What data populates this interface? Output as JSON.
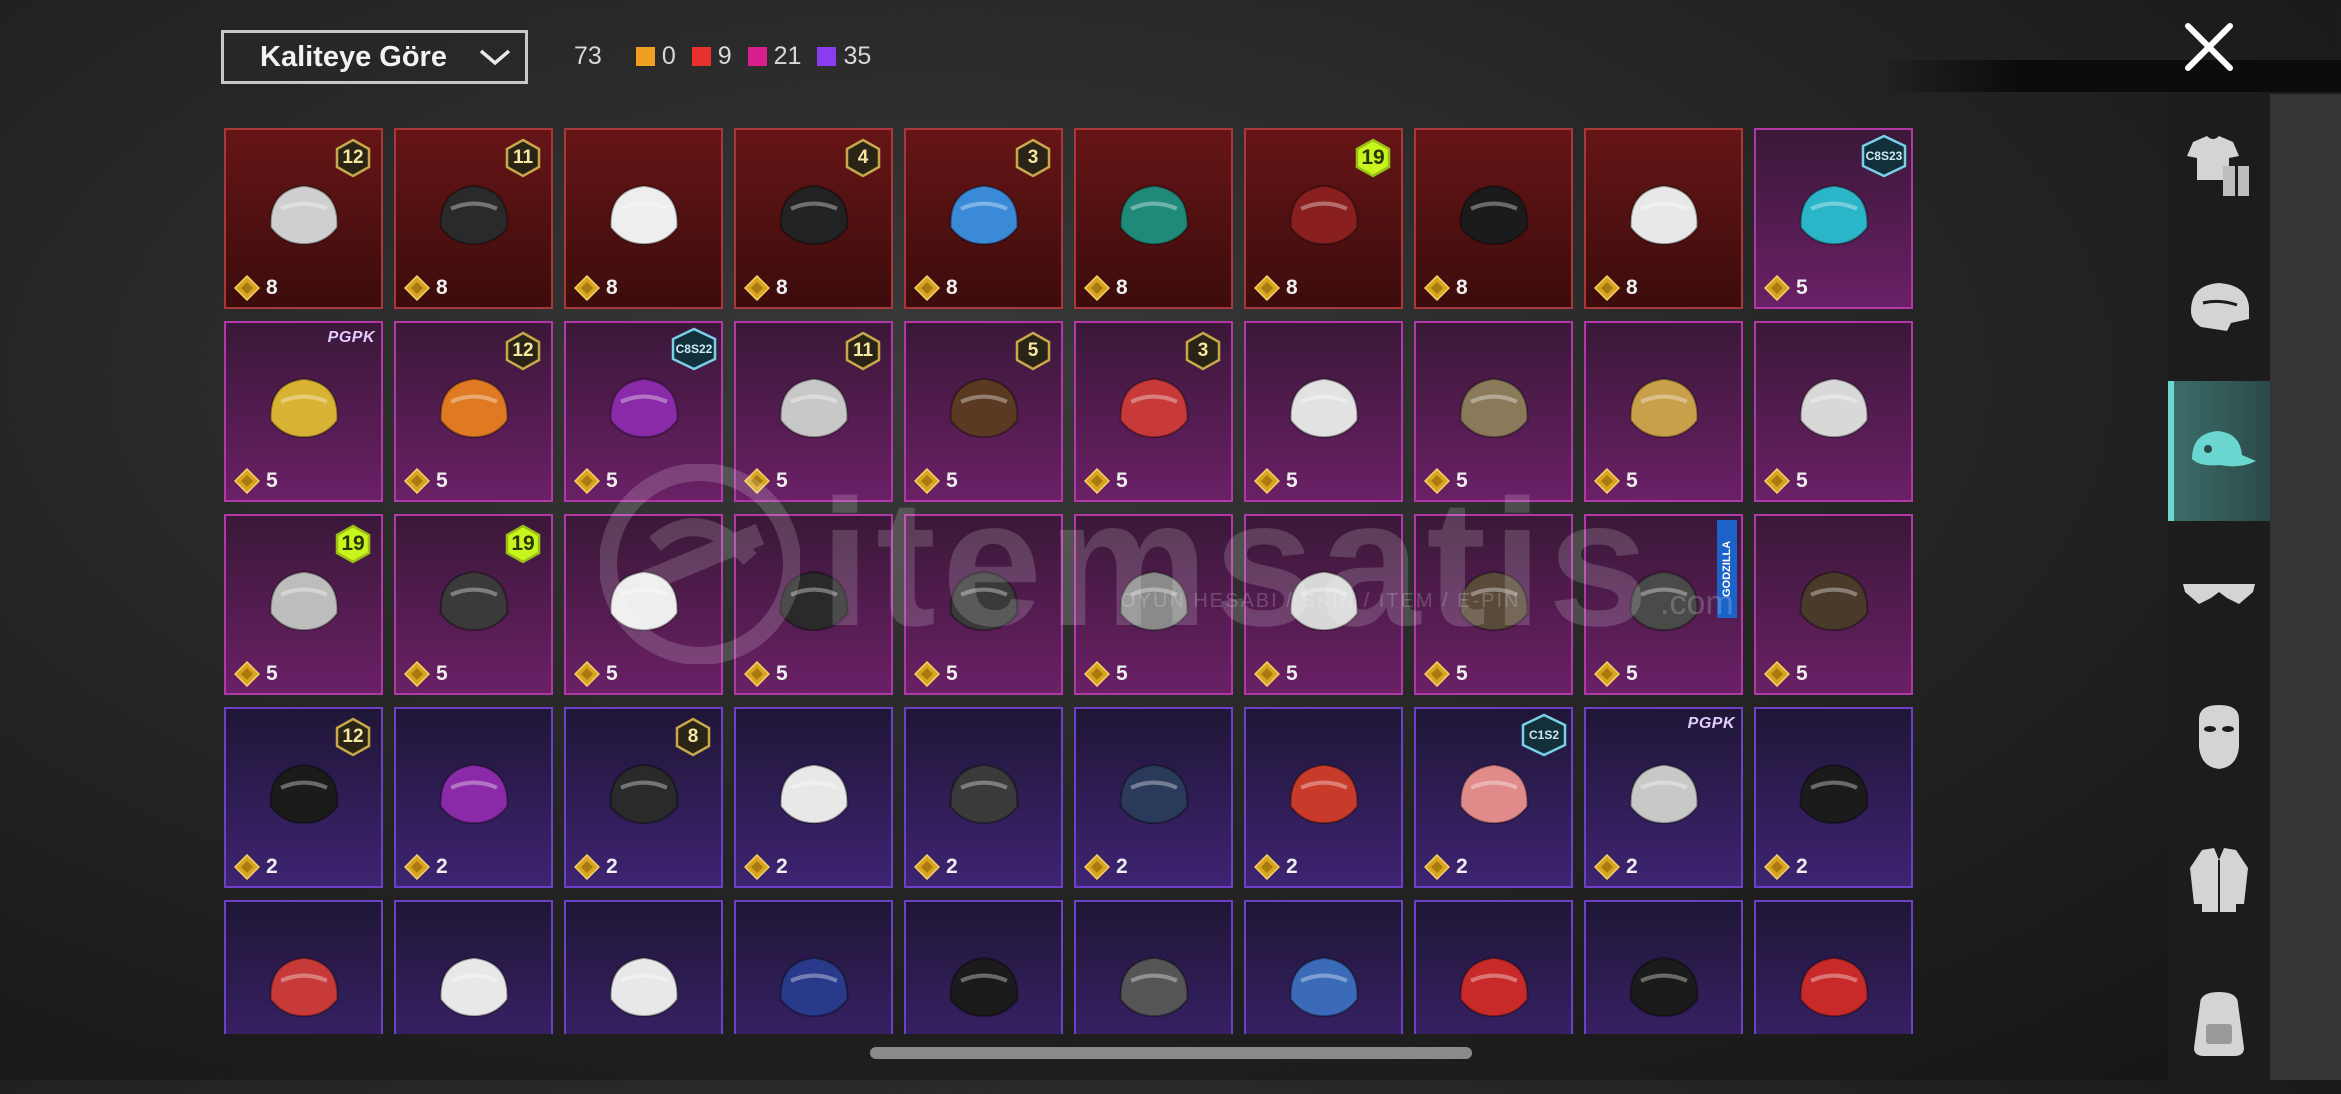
{
  "header": {
    "sort_label": "Kaliteye Göre",
    "total_count": "73",
    "counts": [
      {
        "value": "0",
        "color": "#f0a020"
      },
      {
        "value": "9",
        "color": "#e8302c"
      },
      {
        "value": "21",
        "color": "#d8208c"
      },
      {
        "value": "35",
        "color": "#8a3cf0"
      }
    ]
  },
  "watermark": {
    "brand": "itemsatis",
    "tagline": "OYUN HESABI / SKIN / ITEM / E-PIN",
    "domain": ".com"
  },
  "sidebar": {
    "items": [
      {
        "icon": "outfit-icon",
        "active": false
      },
      {
        "icon": "helmet-icon",
        "active": false
      },
      {
        "icon": "cap-icon",
        "active": true
      },
      {
        "icon": "glasses-icon",
        "active": false
      },
      {
        "icon": "mask-icon",
        "active": false
      },
      {
        "icon": "jacket-icon",
        "active": false
      },
      {
        "icon": "backpack-icon",
        "active": false
      }
    ]
  },
  "items": [
    {
      "rarity": "red",
      "qty": "8",
      "badge": "12",
      "badge_type": "level",
      "icon": "white-hair-bow-headwear-icon"
    },
    {
      "rarity": "red",
      "qty": "8",
      "badge": "11",
      "badge_type": "level",
      "icon": "black-hair-headwear-icon"
    },
    {
      "rarity": "red",
      "qty": "8",
      "badge": "",
      "badge_type": "",
      "icon": "white-cowboy-hat-icon"
    },
    {
      "rarity": "red",
      "qty": "8",
      "badge": "4",
      "badge_type": "level",
      "icon": "snowman-top-hat-icon"
    },
    {
      "rarity": "red",
      "qty": "8",
      "badge": "3",
      "badge_type": "level",
      "icon": "joker-mask-headwear-icon"
    },
    {
      "rarity": "red",
      "qty": "8",
      "badge": "",
      "badge_type": "",
      "icon": "teal-dragon-helmet-icon"
    },
    {
      "rarity": "red",
      "qty": "8",
      "badge": "19",
      "badge_type": "level-green",
      "icon": "samurai-helmet-icon"
    },
    {
      "rarity": "red",
      "qty": "8",
      "badge": "",
      "badge_type": "",
      "icon": "tricorn-hat-icon"
    },
    {
      "rarity": "red",
      "qty": "8",
      "badge": "",
      "badge_type": "",
      "icon": "checkered-hood-icon"
    },
    {
      "rarity": "pink",
      "qty": "5",
      "badge": "C8S23",
      "badge_type": "season",
      "icon": "cat-ear-headphones-icon"
    },
    {
      "rarity": "pink",
      "qty": "5",
      "badge": "PGPK",
      "badge_type": "brand",
      "icon": "cap-sunglasses-icon"
    },
    {
      "rarity": "pink",
      "qty": "5",
      "badge": "12",
      "badge_type": "level",
      "icon": "orange-pigtails-hair-icon"
    },
    {
      "rarity": "pink",
      "qty": "5",
      "badge": "C8S22",
      "badge_type": "season",
      "icon": "purple-teal-hair-icon"
    },
    {
      "rarity": "pink",
      "qty": "5",
      "badge": "11",
      "badge_type": "level",
      "icon": "flower-crown-hair-icon"
    },
    {
      "rarity": "pink",
      "qty": "5",
      "badge": "5",
      "badge_type": "level",
      "icon": "brown-pigtails-hair-icon"
    },
    {
      "rarity": "pink",
      "qty": "5",
      "badge": "3",
      "badge_type": "level",
      "icon": "jester-hat-icon"
    },
    {
      "rarity": "pink",
      "qty": "5",
      "badge": "",
      "badge_type": "",
      "icon": "white-hair-pair-icon"
    },
    {
      "rarity": "pink",
      "qty": "5",
      "badge": "",
      "badge_type": "",
      "icon": "spiked-helmet-icon"
    },
    {
      "rarity": "pink",
      "qty": "5",
      "badge": "",
      "badge_type": "",
      "icon": "cake-hat-icon"
    },
    {
      "rarity": "pink",
      "qty": "5",
      "badge": "",
      "badge_type": "",
      "icon": "tiger-helmet-icon"
    },
    {
      "rarity": "pink",
      "qty": "5",
      "badge": "19",
      "badge_type": "level-green",
      "icon": "cat-ear-hair-icon"
    },
    {
      "rarity": "pink",
      "qty": "5",
      "badge": "19",
      "badge_type": "level-green",
      "icon": "goggle-helmet-icon"
    },
    {
      "rarity": "pink",
      "qty": "5",
      "badge": "",
      "badge_type": "",
      "icon": "piano-fedora-icon"
    },
    {
      "rarity": "pink",
      "qty": "5",
      "badge": "",
      "badge_type": "",
      "icon": "ribbon-bow-hat-icon"
    },
    {
      "rarity": "pink",
      "qty": "5",
      "badge": "",
      "badge_type": "",
      "icon": "feather-hat-icon"
    },
    {
      "rarity": "pink",
      "qty": "5",
      "badge": "",
      "badge_type": "",
      "icon": "wolf-mask-icon"
    },
    {
      "rarity": "pink",
      "qty": "5",
      "badge": "",
      "badge_type": "",
      "icon": "alien-helmet-pair-icon"
    },
    {
      "rarity": "pink",
      "qty": "5",
      "badge": "",
      "badge_type": "",
      "icon": "warrior-helmet-icon"
    },
    {
      "rarity": "pink",
      "qty": "5",
      "badge": "GODZILLA",
      "badge_type": "godzilla",
      "icon": "godzilla-mask-icon"
    },
    {
      "rarity": "pink",
      "qty": "5",
      "badge": "",
      "badge_type": "",
      "icon": "headband-icon"
    },
    {
      "rarity": "purple",
      "qty": "2",
      "badge": "12",
      "badge_type": "level",
      "icon": "bunny-ear-helmet-icon"
    },
    {
      "rarity": "purple",
      "qty": "2",
      "badge": "",
      "badge_type": "",
      "icon": "horn-headband-icon"
    },
    {
      "rarity": "purple",
      "qty": "2",
      "badge": "8",
      "badge_type": "level",
      "icon": "green-skull-hood-icon"
    },
    {
      "rarity": "purple",
      "qty": "2",
      "badge": "",
      "badge_type": "",
      "icon": "baseball-cap-icon"
    },
    {
      "rarity": "purple",
      "qty": "2",
      "badge": "",
      "badge_type": "",
      "icon": "gas-mask-helmet-icon"
    },
    {
      "rarity": "purple",
      "qty": "2",
      "badge": "",
      "badge_type": "",
      "icon": "beanie-icon"
    },
    {
      "rarity": "purple",
      "qty": "2",
      "badge": "",
      "badge_type": "",
      "icon": "fez-hat-icon"
    },
    {
      "rarity": "purple",
      "qty": "2",
      "badge": "C1S2",
      "badge_type": "season",
      "icon": "striped-bandana-icon"
    },
    {
      "rarity": "purple",
      "qty": "2",
      "badge": "PGPK",
      "badge_type": "brand",
      "icon": "silver-bob-hair-icon"
    },
    {
      "rarity": "purple",
      "qty": "2",
      "badge": "",
      "badge_type": "",
      "icon": "black-fedora-icon"
    },
    {
      "rarity": "purple",
      "qty": "",
      "badge": "",
      "badge_type": "",
      "icon": "mushroom-hat-icon"
    },
    {
      "rarity": "purple",
      "qty": "",
      "badge": "",
      "badge_type": "",
      "icon": "clown-mask-hair-icon"
    },
    {
      "rarity": "purple",
      "qty": "",
      "badge": "",
      "badge_type": "",
      "icon": "white-turban-icon"
    },
    {
      "rarity": "purple",
      "qty": "",
      "badge": "",
      "badge_type": "",
      "icon": "bird-beanie-icon"
    },
    {
      "rarity": "purple",
      "qty": "",
      "badge": "",
      "badge_type": "",
      "icon": "pirate-hat-icon"
    },
    {
      "rarity": "purple",
      "qty": "",
      "badge": "",
      "badge_type": "",
      "icon": "luchador-mask-icon"
    },
    {
      "rarity": "purple",
      "qty": "",
      "badge": "",
      "badge_type": "",
      "icon": "shark-hood-icon"
    },
    {
      "rarity": "purple",
      "qty": "",
      "badge": "",
      "badge_type": "",
      "icon": "red-beret-icon"
    },
    {
      "rarity": "purple",
      "qty": "",
      "badge": "",
      "badge_type": "",
      "icon": "black-top-hat-icon"
    },
    {
      "rarity": "purple",
      "qty": "",
      "badge": "",
      "badge_type": "",
      "icon": "red-fedora-icon"
    }
  ],
  "colors": {
    "accent": "#6ad6cf",
    "red_tier": "#a8383a",
    "pink_tier": "#b238a8",
    "purple_tier": "#6d40c8"
  }
}
